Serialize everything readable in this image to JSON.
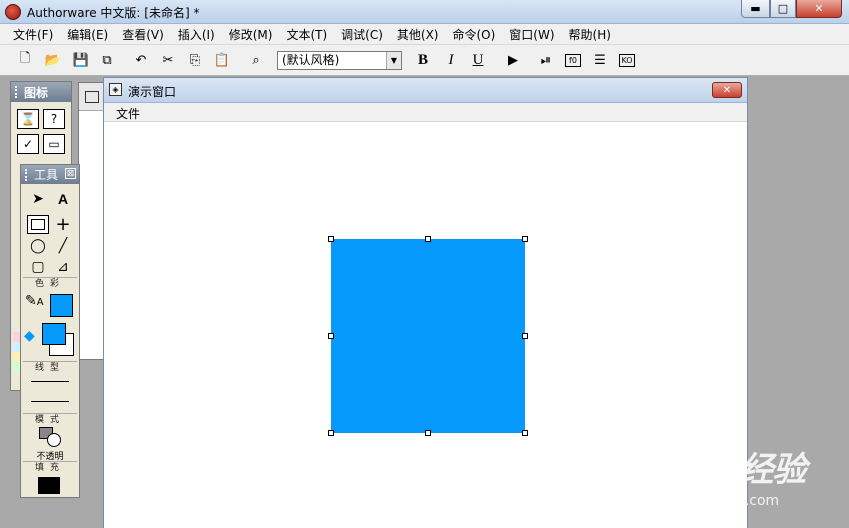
{
  "window": {
    "title": "Authorware 中文版: [未命名] *",
    "min_glyph": "▬",
    "max_glyph": "□",
    "close_glyph": "✕"
  },
  "menu": [
    "文件(F)",
    "编辑(E)",
    "查看(V)",
    "插入(I)",
    "修改(M)",
    "文本(T)",
    "调试(C)",
    "其他(X)",
    "命令(O)",
    "窗口(W)",
    "帮助(H)"
  ],
  "toolbar": {
    "new_icon": "🗋",
    "open_icon": "📂",
    "save_all_icon": "💾",
    "import_icon": "⧉",
    "undo_icon": "↶",
    "cut_icon": "✂",
    "copy_icon": "⎘",
    "paste_icon": "📋",
    "find_icon": "⌕",
    "style_value": "(默认风格)",
    "style_arrow": "▼",
    "bold": "B",
    "italic": "I",
    "underline": "U",
    "run_icon": "▶",
    "control_panel_icon": "⏯",
    "functions": "f0",
    "variables": "☰",
    "knowledge_objects": "KO"
  },
  "icon_palette": {
    "title": "图标",
    "icons": [
      "⌛",
      "?",
      "✓",
      "▭"
    ]
  },
  "tools_palette": {
    "title": "工具",
    "close_glyph": "⊠",
    "pointer": "➤",
    "text_tool": "A",
    "rectangle": "□",
    "crosshair": "+",
    "ellipse": "◯",
    "line": "╱",
    "rounded_rect": "▢",
    "polygon": "⊿",
    "color_label": "色彩",
    "line_label": "线型",
    "mode_label": "模式",
    "mode_value": "不透明",
    "fill_label": "填充",
    "pencil_text_label": "A"
  },
  "presentation": {
    "title": "演示窗口",
    "menu_file": "文件",
    "close_glyph": "✕"
  },
  "shape": {
    "type": "rectangle",
    "fill_color": "#0599fc",
    "selected": true
  },
  "colors": {
    "foreground_swatch": "#0599fc",
    "fill_swatch": "#000000"
  },
  "watermark": {
    "logo": "Baidu经验",
    "url": "jingyan.baidu.com"
  }
}
